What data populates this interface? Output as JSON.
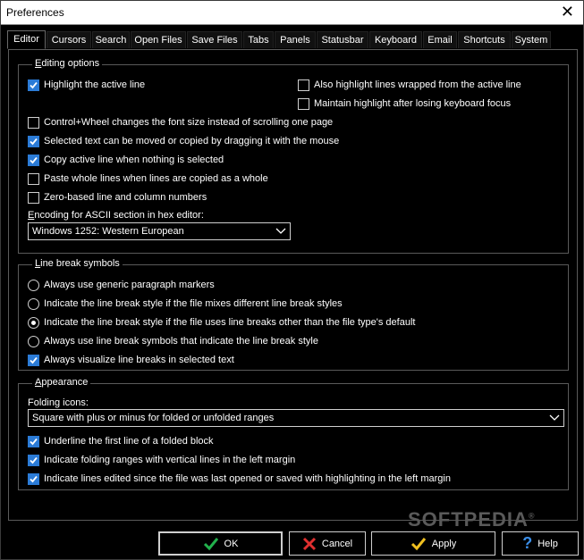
{
  "window": {
    "title": "Preferences"
  },
  "tabs": [
    {
      "label": "Editor",
      "active": true
    },
    {
      "label": "Cursors"
    },
    {
      "label": "Search"
    },
    {
      "label": "Open Files"
    },
    {
      "label": "Save Files"
    },
    {
      "label": "Tabs"
    },
    {
      "label": "Panels"
    },
    {
      "label": "Statusbar"
    },
    {
      "label": "Keyboard"
    },
    {
      "label": "Email"
    },
    {
      "label": "Shortcuts"
    },
    {
      "label": "System"
    }
  ],
  "editing": {
    "legend_hot": "E",
    "legend_rest": "diting options",
    "items": [
      {
        "label": "Highlight the active line",
        "checked": true
      },
      {
        "label": "Also highlight lines wrapped from the active line",
        "checked": false
      },
      {
        "label": "Maintain highlight after losing keyboard focus",
        "checked": false
      },
      {
        "label": "Control+Wheel changes the font size instead of scrolling one page",
        "checked": false
      },
      {
        "label": "Selected text can be moved or copied by dragging it with the mouse",
        "checked": true
      },
      {
        "label": "Copy active line when nothing is selected",
        "checked": true
      },
      {
        "label": "Paste whole lines when lines are copied as a whole",
        "checked": false
      },
      {
        "label": "Zero-based line and column numbers",
        "checked": false
      }
    ],
    "encoding_label_hot": "E",
    "encoding_label_rest": "ncoding for ASCII section in hex editor:",
    "encoding_value": "Windows 1252: Western European"
  },
  "linebreak": {
    "legend_hot": "L",
    "legend_rest": "ine break symbols",
    "options": [
      {
        "label": "Always use generic paragraph markers",
        "selected": false
      },
      {
        "label": "Indicate the line break style if the file mixes different line break styles",
        "selected": false
      },
      {
        "label": "Indicate the line break style if the file uses line breaks other than the file type's default",
        "selected": true
      },
      {
        "label": "Always use line break symbols that indicate the line break style",
        "selected": false
      }
    ],
    "visualize": {
      "label": "Always visualize line breaks in selected text",
      "checked": true
    }
  },
  "appearance": {
    "legend_hot": "A",
    "legend_rest": "ppearance",
    "folding_label": "Folding icons:",
    "folding_value": "Square with plus or minus for folded or unfolded ranges",
    "items": [
      {
        "label": "Underline the first line of a folded block",
        "checked": true
      },
      {
        "label": "Indicate folding ranges with vertical lines in the left margin",
        "checked": true
      },
      {
        "label": "Indicate lines edited since the file was last opened or saved with highlighting in the left margin",
        "checked": true
      }
    ]
  },
  "buttons": {
    "ok": "OK",
    "cancel": "Cancel",
    "apply": "Apply",
    "help": "Help"
  },
  "colors": {
    "accent": "#2b7bd6",
    "ok": "#22b14c",
    "cancel": "#e03030",
    "apply": "#f0c020",
    "help": "#3a8ee8"
  },
  "watermark": "SOFTPEDIA"
}
